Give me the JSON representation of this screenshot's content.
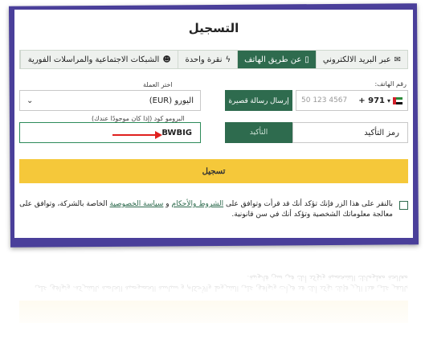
{
  "form": {
    "title": "التسجيل",
    "tabs": [
      {
        "label": "عبر البريد الالكتروني",
        "icon": "envelope-icon"
      },
      {
        "label": "عن طريق الهاتف",
        "icon": "phone-icon",
        "active": true
      },
      {
        "label": "نقرة واحدة",
        "icon": "bolt-icon"
      },
      {
        "label": "الشبكات الاجتماعية والمراسلات الفورية",
        "icon": "users-icon"
      }
    ],
    "phone": {
      "label": "رقم الهاتف:",
      "country_code": "+ 971",
      "placeholder": "50 123 4567"
    },
    "sms_button": "إرسال رسالة قصيرة",
    "currency": {
      "label": "اختر العملة",
      "value": "اليورو (EUR)"
    },
    "confirm_code": {
      "placeholder": "رمز التأكيد"
    },
    "confirm_button": "التأكيد",
    "promo": {
      "label": "البرومو كود (إذا كان موجودًا عندك)",
      "value": "BWBIG"
    },
    "register_button": "تسجيل",
    "terms": {
      "before": "بالنقر على هذا الزر فإنك تؤكد أنك قد قرأت وتوافق على ",
      "terms_link": "الشروط والأحكام",
      "middle": " و ",
      "privacy_link": "سياسة الخصوصية",
      "after": " الخاصة بالشركة، وتوافق على معالجة معلوماتك الشخصية وتؤكد أنك في سن قانونية."
    }
  },
  "colors": {
    "frame": "#4a3f9a",
    "accent": "#2e6b4e",
    "register": "#f5c83a",
    "arrow": "#e0201e"
  }
}
